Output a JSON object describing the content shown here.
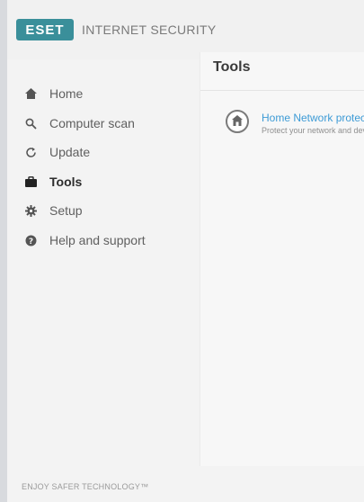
{
  "header": {
    "logo_text": "ESET",
    "product_name": "INTERNET SECURITY"
  },
  "sidebar": {
    "items": [
      {
        "label": "Home",
        "icon": "home-icon"
      },
      {
        "label": "Computer scan",
        "icon": "search-icon"
      },
      {
        "label": "Update",
        "icon": "refresh-icon"
      },
      {
        "label": "Tools",
        "icon": "briefcase-icon",
        "active": true
      },
      {
        "label": "Setup",
        "icon": "gear-icon"
      },
      {
        "label": "Help and support",
        "icon": "help-icon"
      }
    ],
    "footer": "ENJOY SAFER TECHNOLOGY™"
  },
  "main": {
    "title": "Tools",
    "tools": [
      {
        "title": "Home Network protection",
        "description": "Protect your network and devices",
        "icon": "network-icon"
      }
    ]
  },
  "colors": {
    "brand": "#3a8f9a",
    "link": "#3d9bd6"
  }
}
